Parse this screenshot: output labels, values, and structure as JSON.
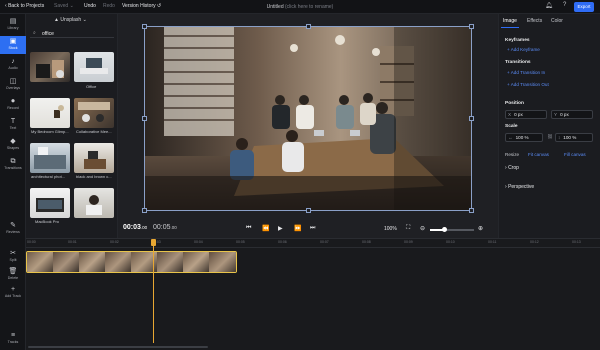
{
  "header": {
    "back": "Back to Projects",
    "saved": "Saved",
    "undo": "Undo",
    "redo": "Redo",
    "version_history": "Version History",
    "project_title": "Untitled",
    "rename_hint": "(click here to rename)",
    "export": "Export"
  },
  "rail": {
    "items": [
      {
        "label": "Library",
        "icon": "library-icon"
      },
      {
        "label": "Stock",
        "icon": "stock-icon"
      },
      {
        "label": "Audio",
        "icon": "music-icon"
      },
      {
        "label": "Overlays",
        "icon": "overlays-icon"
      },
      {
        "label": "Record",
        "icon": "record-icon"
      },
      {
        "label": "Text",
        "icon": "text-icon"
      },
      {
        "label": "Shapes",
        "icon": "shapes-icon"
      },
      {
        "label": "Transitions",
        "icon": "transitions-icon"
      },
      {
        "label": "Reviews",
        "icon": "reviews-icon"
      },
      {
        "label": "Split",
        "icon": "split-icon"
      },
      {
        "label": "Delete",
        "icon": "delete-icon"
      },
      {
        "label": "Add Track",
        "icon": "add-track-icon"
      },
      {
        "label": "Tracks",
        "icon": "tracks-icon"
      }
    ]
  },
  "media": {
    "source": "Unsplash",
    "search_value": "office",
    "items": [
      {
        "label": ""
      },
      {
        "label": "Office"
      },
      {
        "label": "My Bedroom Glimp..."
      },
      {
        "label": "Collaborative Mee..."
      },
      {
        "label": "architectural phot..."
      },
      {
        "label": "black and brown c..."
      },
      {
        "label": "MacBook Pro"
      },
      {
        "label": ""
      }
    ]
  },
  "transport": {
    "current_time": "00:03",
    "current_frac": ".00",
    "total_time": "00:05",
    "total_frac": ".00",
    "zoom": "100%",
    "zoom_level": 0.3
  },
  "properties": {
    "tabs": [
      "Image",
      "Effects",
      "Color"
    ],
    "keyframes": {
      "title": "Keyframes",
      "add": "Add Keyframe"
    },
    "transitions": {
      "title": "Transitions",
      "add_in": "Add Transition In",
      "add_out": "Add Transition Out"
    },
    "position": {
      "title": "Position",
      "x_key": "X",
      "x": "0 px",
      "y_key": "Y",
      "y": "0 px"
    },
    "scale": {
      "title": "Scale",
      "w": "100 %",
      "h": "100 %"
    },
    "resize": {
      "title": "Resize",
      "fit": "Fit canvas",
      "fill": "Fill canvas"
    },
    "crop": "Crop",
    "perspective": "Perspective"
  },
  "timeline": {
    "ticks": [
      "00:00",
      "00:01",
      "00:02",
      "00:03",
      "00:04",
      "00:05",
      "00:06",
      "00:07",
      "00:08",
      "00:09",
      "00:10",
      "00:11",
      "00:12",
      "00:13"
    ]
  },
  "colors": {
    "accent": "#2f6cf5",
    "clip_border": "#e8c44a",
    "playhead": "#e8a732"
  }
}
